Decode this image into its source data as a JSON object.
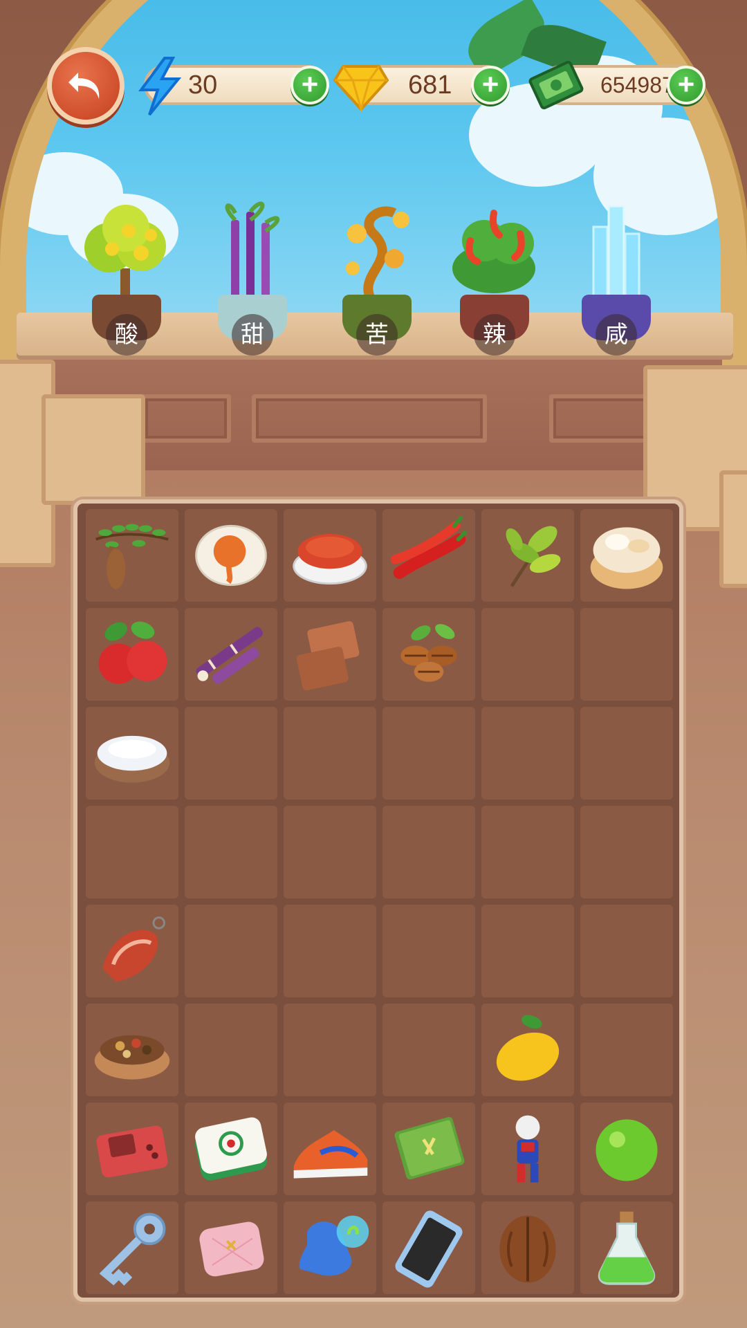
{
  "hud": {
    "energy": "30",
    "gems": "681",
    "cash": "654987"
  },
  "flavors": [
    {
      "label": "酸",
      "icon": "lemon-tree-icon",
      "pot_color": "#7b4a33"
    },
    {
      "label": "甜",
      "icon": "sugarcane-plant-icon",
      "pot_color": "#a9cfd0"
    },
    {
      "label": "苦",
      "icon": "golden-vine-icon",
      "pot_color": "#5e7a2c"
    },
    {
      "label": "辣",
      "icon": "chili-plant-icon",
      "pot_color": "#8a3f34"
    },
    {
      "label": "咸",
      "icon": "salt-crystal-icon",
      "pot_color": "#5a4bab"
    }
  ],
  "inventory": [
    [
      "tamarind-icon",
      "salted-egg-icon",
      "chili-powder-icon",
      "red-chili-icon",
      "tea-leaves-icon",
      "cream-puff-icon"
    ],
    [
      "hawthorn-icon",
      "sugarcane-icon",
      "brown-sugar-icon",
      "coffee-beans-icon",
      "",
      ""
    ],
    [
      "sea-salt-icon",
      "",
      "",
      "",
      "",
      ""
    ],
    [
      "",
      "",
      "",
      "",
      "",
      ""
    ],
    [
      "ham-icon",
      "",
      "",
      "",
      "",
      ""
    ],
    [
      "mixed-spices-icon",
      "",
      "",
      "",
      "lemon-icon",
      ""
    ],
    [
      "game-console-icon",
      "mahjong-tile-icon",
      "sneaker-icon",
      "notebook-icon",
      "hero-figure-icon",
      "lime-icon"
    ],
    [
      "key-icon",
      "pink-purse-icon",
      "blue-glove-icon",
      "smartphone-icon",
      "walnut-icon",
      "green-potion-icon"
    ]
  ]
}
